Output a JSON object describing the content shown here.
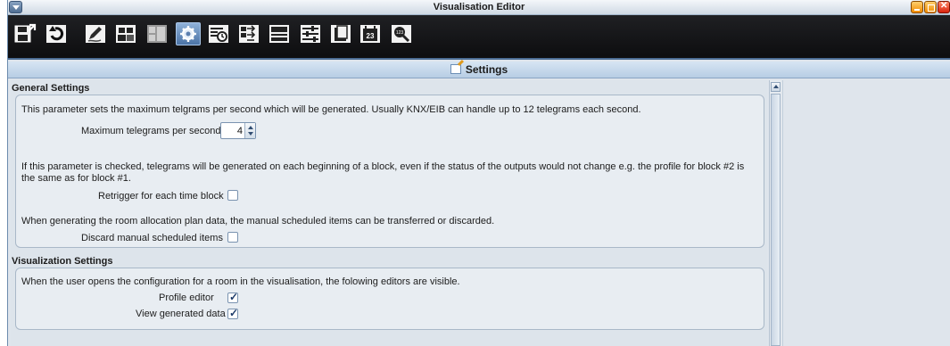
{
  "window": {
    "title": "Visualisation Editor"
  },
  "toolbar": {
    "buttons": [
      {
        "icon": "save-exit-icon"
      },
      {
        "icon": "undo-icon"
      },
      {
        "icon": "edit-pencil-icon"
      },
      {
        "icon": "people-icon"
      },
      {
        "icon": "layout-grid-icon"
      },
      {
        "icon": "settings-gear-icon",
        "active": true
      },
      {
        "icon": "calendar-clock-icon"
      },
      {
        "icon": "export-arrows-icon"
      },
      {
        "icon": "list-panel-icon"
      },
      {
        "icon": "sliders-icon"
      },
      {
        "icon": "document-icon"
      },
      {
        "icon": "calendar-23-icon",
        "badge": "23"
      },
      {
        "icon": "magnifier-icon",
        "badge": "123"
      }
    ]
  },
  "header": {
    "title": "Settings"
  },
  "general": {
    "title": "General Settings",
    "desc1": "This parameter sets the maximum telgrams per second which will be generated. Usually KNX/EIB can handle up to 12 telegrams each second.",
    "max_label": "Maximum telegrams per second",
    "max_value": "4",
    "desc2": "If this parameter is checked, telegrams will be generated on each beginning of a block, even if the status of the outputs would not change e.g. the profile for block #2 is the same as for block #1.",
    "retrigger_label": "Retrigger for each time block",
    "retrigger_checked": false,
    "desc3": "When generating the room allocation plan data, the manual scheduled items can be transferred or discarded.",
    "discard_label": "Discard manual scheduled items",
    "discard_checked": false
  },
  "visualization": {
    "title": "Visualization Settings",
    "desc": "When the user opens the configuration for a room in the visualisation, the folowing editors are visible.",
    "profile_label": "Profile editor",
    "profile_checked": true,
    "view_label": "View generated data",
    "view_checked": true
  }
}
